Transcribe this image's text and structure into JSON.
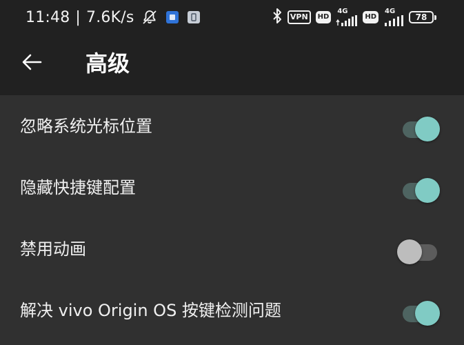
{
  "status_bar": {
    "time": "11:48",
    "separator": "|",
    "net_speed": "7.6K/s",
    "vpn_label": "VPN",
    "hd_label": "HD",
    "net_type_1": "4G",
    "net_type_2": "4G",
    "battery_level": "78"
  },
  "toolbar": {
    "title": "高级"
  },
  "settings": [
    {
      "label": "忽略系统光标位置",
      "enabled": true
    },
    {
      "label": "隐藏快捷键配置",
      "enabled": true
    },
    {
      "label": "禁用动画",
      "enabled": false
    },
    {
      "label": "解决 vivo Origin OS 按键检测问题",
      "enabled": true
    }
  ],
  "colors": {
    "toolbar_bg": "#212121",
    "page_bg": "#303030",
    "switch_on_track": "#4e6461",
    "switch_on_thumb": "#80cbc4",
    "switch_off_track": "#5c5c5c",
    "switch_off_thumb": "#bdbdbd"
  }
}
